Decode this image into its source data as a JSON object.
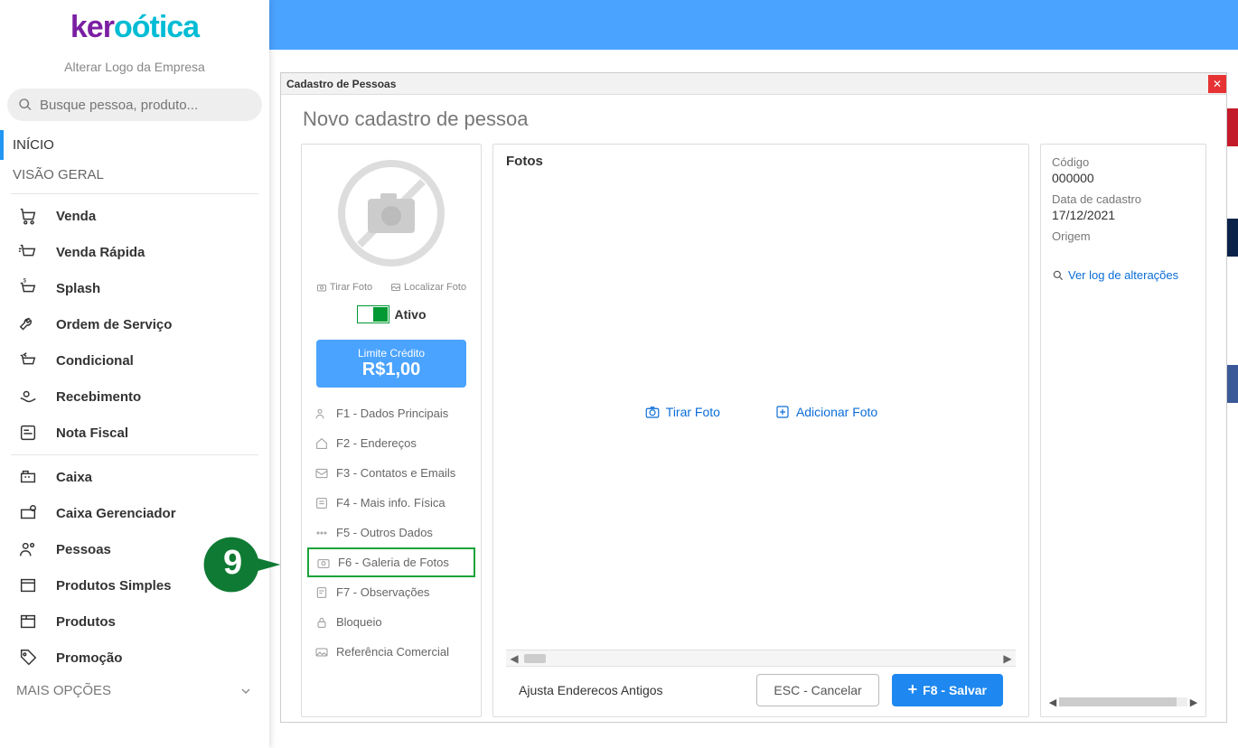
{
  "brand": {
    "part1": "ker",
    "part2": "ótica"
  },
  "changeLogo": "Alterar Logo da Empresa",
  "search": {
    "placeholder": "Busque pessoa, produto..."
  },
  "navHead": {
    "inicio": "INÍCIO",
    "visao": "VISÃO GERAL",
    "mais": "MAIS OPÇÕES"
  },
  "nav": [
    {
      "label": "Venda"
    },
    {
      "label": "Venda Rápida"
    },
    {
      "label": "Splash"
    },
    {
      "label": "Ordem de Serviço"
    },
    {
      "label": "Condicional"
    },
    {
      "label": "Recebimento"
    },
    {
      "label": "Nota Fiscal"
    }
  ],
  "nav2": [
    {
      "label": "Caixa"
    },
    {
      "label": "Caixa Gerenciador"
    },
    {
      "label": "Pessoas"
    },
    {
      "label": "Produtos Simples"
    },
    {
      "label": "Produtos"
    },
    {
      "label": "Promoção"
    }
  ],
  "window": {
    "title": "Cadastro de Pessoas"
  },
  "page": {
    "title": "Novo cadastro de pessoa"
  },
  "leftPanel": {
    "tirarFoto": "Tirar Foto",
    "localizarFoto": "Localizar Foto",
    "ativo": "Ativo",
    "credit": {
      "label": "Limite Crédito",
      "value": "R$1,00"
    },
    "tabs": [
      {
        "label": "F1 - Dados Principais"
      },
      {
        "label": "F2 - Endereços"
      },
      {
        "label": "F3 - Contatos e Emails"
      },
      {
        "label": "F4 - Mais info. Física"
      },
      {
        "label": "F5 - Outros Dados"
      },
      {
        "label": "F6 - Galeria de Fotos"
      },
      {
        "label": "F7 - Observações"
      },
      {
        "label": "Bloqueio"
      },
      {
        "label": "Referência Comercial"
      }
    ]
  },
  "center": {
    "heading": "Fotos",
    "tirarFoto": "Tirar Foto",
    "adicionarFoto": "Adicionar Foto"
  },
  "footer": {
    "left": "Ajusta Enderecos Antigos",
    "cancel": "ESC - Cancelar",
    "save": "F8 - Salvar"
  },
  "rightPanel": {
    "codigoLbl": "Código",
    "codigoVal": "000000",
    "dataLbl": "Data de cadastro",
    "dataVal": "17/12/2021",
    "origemLbl": "Origem",
    "logLink": "Ver log de alterações"
  },
  "callout": {
    "num": "9"
  }
}
